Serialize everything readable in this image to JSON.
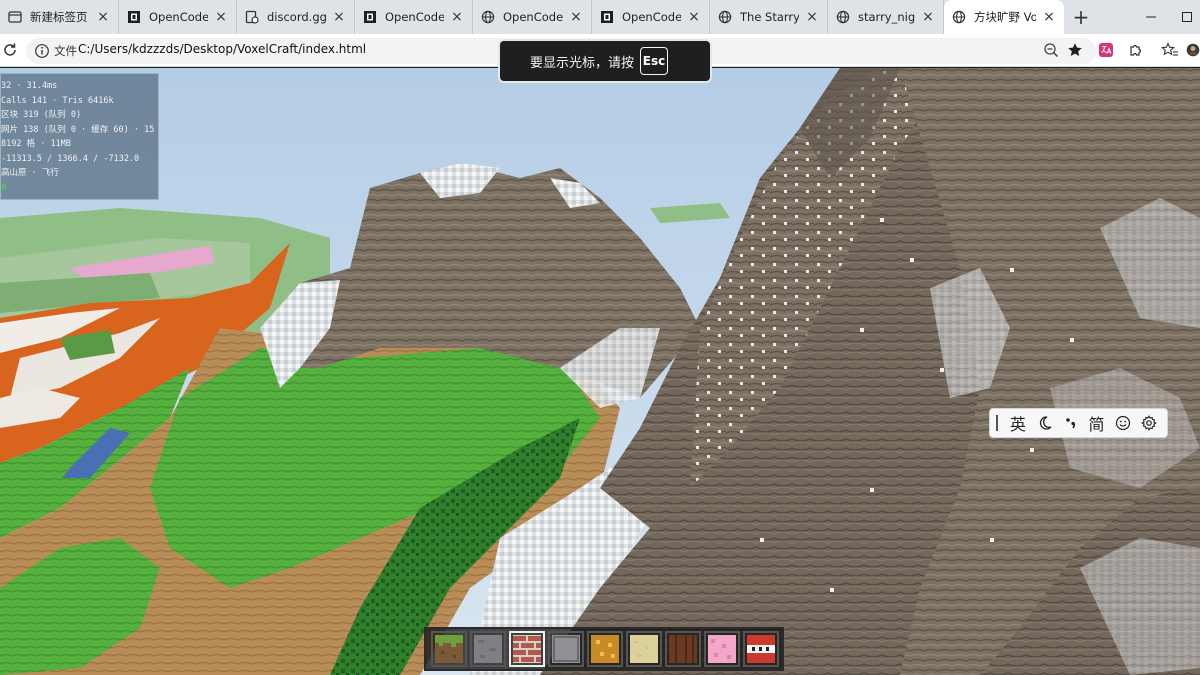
{
  "browser": {
    "tabs": [
      {
        "label": "新建标签页",
        "icon": "new-tab-page-icon",
        "active": false
      },
      {
        "label": "OpenCode",
        "icon": "opencode-icon",
        "active": false
      },
      {
        "label": "discord.gg",
        "icon": "discord-icon",
        "active": false
      },
      {
        "label": "OpenCode",
        "icon": "opencode-icon",
        "active": false
      },
      {
        "label": "OpenCode · Mi",
        "icon": "globe-icon",
        "active": false
      },
      {
        "label": "OpenCode",
        "icon": "opencode-icon",
        "active": false
      },
      {
        "label": "The Starry Night",
        "icon": "globe-icon",
        "active": false
      },
      {
        "label": "starry_night.svg",
        "icon": "globe-icon",
        "active": false
      },
      {
        "label": "方块旷野 VoxelC",
        "icon": "globe-icon",
        "active": true
      }
    ],
    "new_tab_symbol": "+",
    "address": {
      "scheme_label": "文件",
      "url": "C:/Users/kdzzzds/Desktop/VoxelCraft/index.html"
    },
    "accent": "#1a73e8"
  },
  "pointer_lock_toast": {
    "message": "要显示光标，请按",
    "key": "Esc"
  },
  "debug_overlay": {
    "lines": [
      "32 · 31.4ms",
      "Calls 141 · Tris 6416k",
      "区块 319 (队列 0)",
      "网片 138 (队列 0 · 缓存 60) · 15",
      " 8192 格 · 11MB",
      "-11313.5 / 1366.4 / -7132.0",
      " 高山原 · 飞行",
      "0"
    ]
  },
  "ime_toolbar": {
    "mode_label": "英",
    "script_label": "简",
    "icons": [
      "moon-icon",
      "punctuation-icon",
      "emoji-icon",
      "gear-icon"
    ]
  },
  "hotbar": {
    "selected_index": 2,
    "slots": [
      {
        "block": "grass",
        "icon": "grass-block-icon",
        "colors": [
          "#6f9e3c",
          "#7b5a38"
        ]
      },
      {
        "block": "stone",
        "icon": "stone-block-icon",
        "colors": [
          "#7f7f85",
          "#6d6d72"
        ]
      },
      {
        "block": "brick",
        "icon": "brick-block-icon",
        "colors": [
          "#b3584c",
          "#d9d0c8"
        ]
      },
      {
        "block": "cobblestone",
        "icon": "cobblestone-block-icon",
        "colors": [
          "#8f8f94",
          "#5d5d62"
        ]
      },
      {
        "block": "gold-ore",
        "icon": "gold-ore-block-icon",
        "colors": [
          "#c98a2a",
          "#f0c040"
        ]
      },
      {
        "block": "sand",
        "icon": "sand-block-icon",
        "colors": [
          "#dcd19a",
          "#cbbf85"
        ]
      },
      {
        "block": "wood",
        "icon": "wood-block-icon",
        "colors": [
          "#6b3a22",
          "#4e2917"
        ]
      },
      {
        "block": "pink-block",
        "icon": "pink-block-icon",
        "colors": [
          "#f2a6c8",
          "#e17fae"
        ]
      },
      {
        "block": "tnt",
        "icon": "tnt-block-icon",
        "colors": [
          "#cc3a2e",
          "#f4f4f4"
        ]
      }
    ]
  },
  "scene": {
    "sky": "#bcd2e8",
    "rock": "#7d7164",
    "rock_dark": "#5f564c",
    "snow": "#e9ecef",
    "grass": "#4fae3a",
    "grass_dark": "#2b7a2a",
    "dirt": "#b58a55",
    "orange": "#d8641e",
    "water": "#4a6fb5"
  }
}
